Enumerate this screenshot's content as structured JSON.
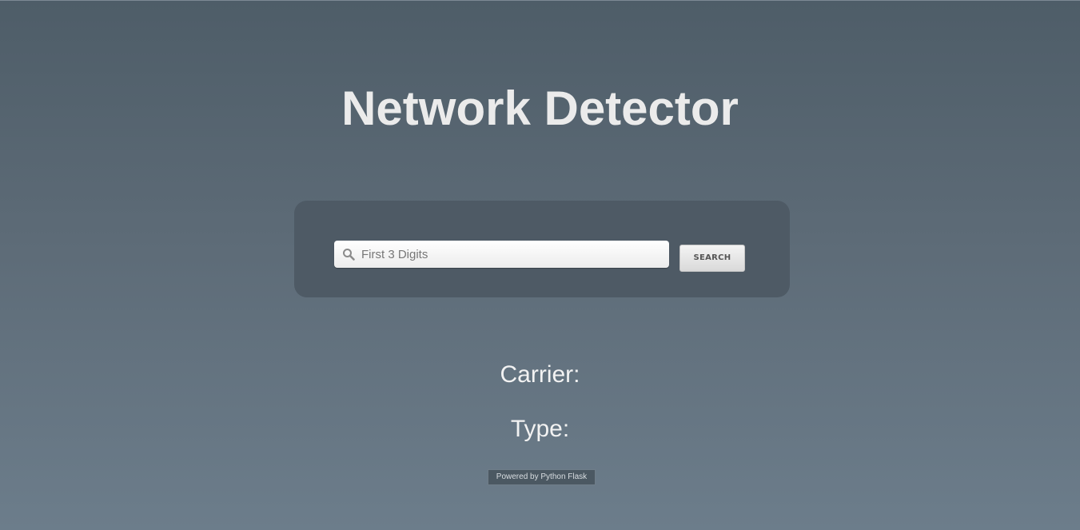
{
  "app": {
    "title": "Network Detector"
  },
  "search": {
    "placeholder": "First 3 Digits",
    "value": "",
    "button_label": "SEARCH",
    "icon": "search-icon"
  },
  "results": {
    "carrier_label": "Carrier:",
    "type_label": "Type:"
  },
  "footer": {
    "badge_text": "Powered by Python Flask"
  },
  "colors": {
    "background_top": "#4e5d68",
    "background_bottom": "#6c7d8b",
    "panel": "#4e5a65",
    "title_text": "#ebebeb"
  }
}
